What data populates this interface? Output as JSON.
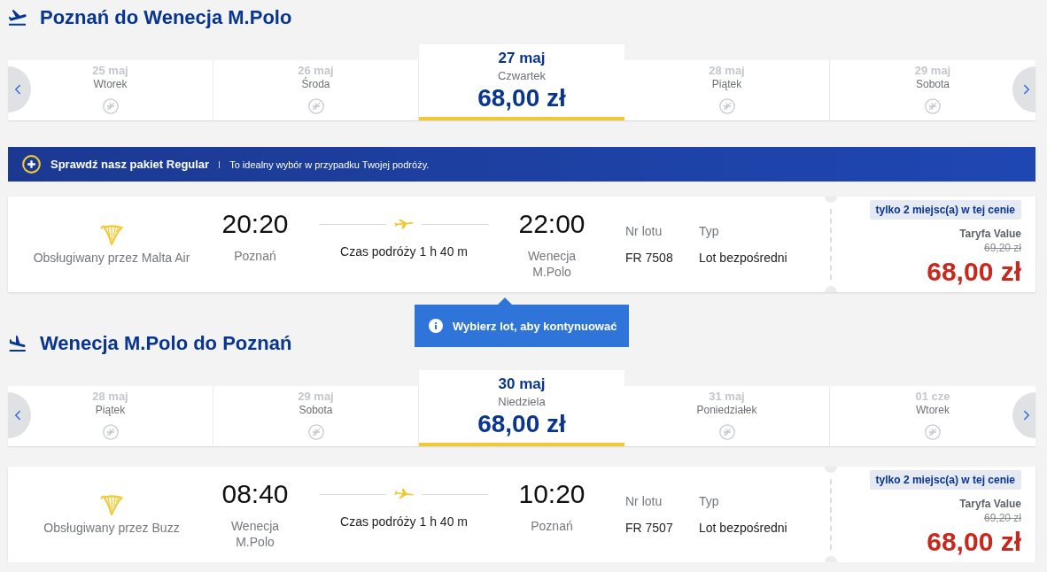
{
  "sections": [
    {
      "kind": "outbound",
      "title": "Poznań do Wenecja M.Polo",
      "dates": [
        {
          "date": "25 maj",
          "day": "Wtorek",
          "selected": false
        },
        {
          "date": "26 maj",
          "day": "Środa",
          "selected": false
        },
        {
          "date": "27 maj",
          "day": "Czwartek",
          "selected": true,
          "price": "68,00 zł"
        },
        {
          "date": "28 maj",
          "day": "Piątek",
          "selected": false
        },
        {
          "date": "29 maj",
          "day": "Sobota",
          "selected": false
        }
      ],
      "banner": {
        "title": "Sprawdź nasz pakiet Regular",
        "text": "To idealny wybór w przypadku Twojej podróży."
      },
      "flight": {
        "operator": "Obsługiwany przez Malta Air",
        "departure": {
          "time": "20:20",
          "city": "Poznań"
        },
        "duration": "Czas podróży 1 h 40 m",
        "arrival": {
          "time": "22:00",
          "city": "Wenecja M.Polo"
        },
        "flight_number": {
          "label": "Nr lotu",
          "value": "FR 7508"
        },
        "type": {
          "label": "Typ",
          "value": "Lot bezpośredni"
        },
        "badge": "tylko 2 miejsc(a) w tej cenie",
        "fare": "Taryfa Value",
        "old_price": "69,20 zł",
        "price": "68,00 zł"
      },
      "tooltip": "Wybierz lot, aby kontynuować"
    },
    {
      "kind": "return",
      "title": "Wenecja M.Polo do Poznań",
      "dates": [
        {
          "date": "28 maj",
          "day": "Piątek",
          "selected": false
        },
        {
          "date": "29 maj",
          "day": "Sobota",
          "selected": false
        },
        {
          "date": "30 maj",
          "day": "Niedziela",
          "selected": true,
          "price": "68,00 zł"
        },
        {
          "date": "31 maj",
          "day": "Poniedziałek",
          "selected": false
        },
        {
          "date": "01 cze",
          "day": "Wtorek",
          "selected": false
        }
      ],
      "flight": {
        "operator": "Obsługiwany przez Buzz",
        "departure": {
          "time": "08:40",
          "city": "Wenecja M.Polo"
        },
        "duration": "Czas podróży 1 h 40 m",
        "arrival": {
          "time": "10:20",
          "city": "Poznań"
        },
        "flight_number": {
          "label": "Nr lotu",
          "value": "FR 7507"
        },
        "type": {
          "label": "Typ",
          "value": "Lot bezpośredni"
        },
        "badge": "tylko 2 miejsc(a) w tej cenie",
        "fare": "Taryfa Value",
        "old_price": "69,20 zł",
        "price": "68,00 zł"
      }
    }
  ]
}
